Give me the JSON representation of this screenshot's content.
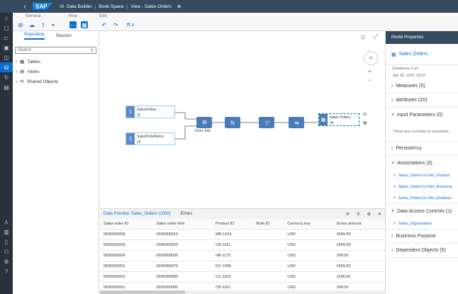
{
  "shell": {
    "back": "‹",
    "logo": "SAP",
    "breadcrumb": [
      "Data Builder",
      "Book Space",
      "View - Sales Orders"
    ],
    "close": "⊗"
  },
  "toolbar": {
    "general": "General",
    "view": "View",
    "edit": "Edit"
  },
  "repo": {
    "tabs": [
      "Repository",
      "Sources"
    ],
    "search_placeholder": "Search",
    "tree": [
      "Tables",
      "Views",
      "Shared Objects"
    ]
  },
  "canvas": {
    "node1": {
      "name": "SalesOrders",
      "sub": "11"
    },
    "node2": {
      "name": "SalesOrderItems",
      "sub": "12"
    },
    "join": "Inner Join",
    "output": {
      "name": "Sales Orders",
      "sub": "26"
    }
  },
  "preview": {
    "title": "Data Preview: Sales_Orders (1000)",
    "errors": "Errors",
    "columns": [
      "Sales order ID",
      "Sales order item",
      "Product ID",
      "Note ID",
      "Currency key",
      "Gross amount"
    ],
    "rows": [
      [
        "0500000000",
        "0000000010",
        "MB-1034",
        "",
        "USD",
        "2499.00"
      ],
      [
        "0500000000",
        "0000000020",
        "CB-1161",
        "",
        "USD",
        "2499.00"
      ],
      [
        "0500000000",
        "0000000030",
        "HB-1175",
        "",
        "USD",
        "399.00"
      ],
      [
        "0500000001",
        "0000000070",
        "RC-1055",
        "",
        "USD",
        "2499.00"
      ],
      [
        "0500000001",
        "0000000080",
        "CC-1021",
        "",
        "USD",
        "1149.00"
      ],
      [
        "0500000001",
        "0000000090",
        "CB-1161",
        "",
        "USD",
        "399.00"
      ]
    ]
  },
  "props": {
    "header": "Model Properties",
    "title": "Sales Orders",
    "meta1": "Employee Can",
    "meta2": "Apr 30, 2021 18:57",
    "measures": "Measures (5)",
    "attributes": "Attributes (20)",
    "params": "Input Parameters (0)",
    "params_empty": "There are currently no paramete",
    "persistency": "Persistency",
    "associations": "Associations (3)",
    "assoc_items": [
      "Sales_Orders to Dim_Product",
      "Sales_Orders to Dim_Business",
      "Sales_Orders to Dim_Employe"
    ],
    "dac": "Data Access Controls (1)",
    "dac_item": "Sales_Organization",
    "business": "Business Purpose",
    "dependents": "Dependent Objects (5)"
  },
  "colors": {
    "shell": "#354a5f",
    "accent": "#0a6ed1",
    "nav": "#29313a"
  }
}
